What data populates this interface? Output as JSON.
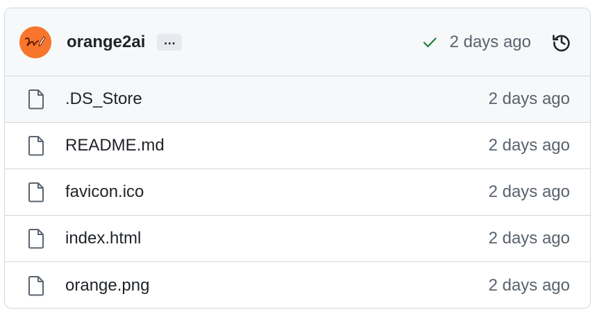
{
  "header": {
    "author": "orange2ai",
    "ellipsis_label": "…",
    "status": "success",
    "commit_time": "2 days ago",
    "accent_color": "#f7752c",
    "success_color": "#1a7f37"
  },
  "files": [
    {
      "name": ".DS_Store",
      "time": "2 days ago",
      "icon": "file-icon"
    },
    {
      "name": "README.md",
      "time": "2 days ago",
      "icon": "file-icon"
    },
    {
      "name": "favicon.ico",
      "time": "2 days ago",
      "icon": "file-icon"
    },
    {
      "name": "index.html",
      "time": "2 days ago",
      "icon": "file-icon"
    },
    {
      "name": "orange.png",
      "time": "2 days ago",
      "icon": "file-icon"
    }
  ]
}
